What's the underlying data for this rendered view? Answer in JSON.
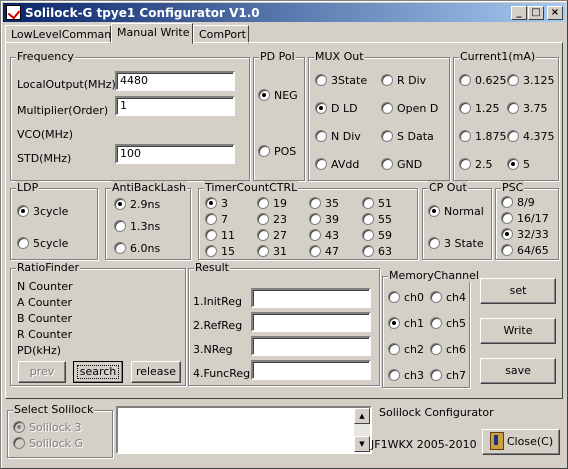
{
  "window": {
    "title": "Solilock-G tpye1 Configurator  V1.0"
  },
  "tabs": [
    {
      "label": "LowLevelCommand"
    },
    {
      "label": "Manual Write"
    },
    {
      "label": "ComPort"
    }
  ],
  "frequency": {
    "caption": "Frequency",
    "local_output_label": "LocalOutput(MHz)",
    "local_output_value": "4480",
    "multiplier_label": "Multiplier(Order)",
    "multiplier_value": "1",
    "vco_label": "VCO(MHz)",
    "std_label": "STD(MHz)",
    "std_value": "100"
  },
  "pd_pol": {
    "caption": "PD Pol",
    "options": [
      "NEG",
      "POS"
    ],
    "selected": "NEG"
  },
  "mux_out": {
    "caption": "MUX Out",
    "options": [
      "3State",
      "R Div",
      "D LD",
      "Open D",
      "N Div",
      "S Data",
      "AVdd",
      "GND"
    ],
    "selected": "D LD"
  },
  "current1": {
    "caption": "Current1(mA)",
    "options": [
      "0.625",
      "3.125",
      "1.25",
      "3.75",
      "1.875",
      "4.375",
      "2.5",
      "5"
    ],
    "selected": "5"
  },
  "ldp": {
    "caption": "LDP",
    "options": [
      "3cycle",
      "5cycle"
    ],
    "selected": "3cycle"
  },
  "antibacklash": {
    "caption": "AntiBackLash",
    "options": [
      "2.9ns",
      "1.3ns",
      "6.0ns"
    ],
    "selected": "2.9ns"
  },
  "timercount": {
    "caption": "TimerCountCTRL",
    "options": [
      "3",
      "19",
      "35",
      "51",
      "7",
      "23",
      "39",
      "55",
      "11",
      "27",
      "43",
      "59",
      "15",
      "31",
      "47",
      "63"
    ],
    "selected": "3"
  },
  "cp_out": {
    "caption": "CP Out",
    "options": [
      "Normal",
      "3 State"
    ],
    "selected": "Normal"
  },
  "psc": {
    "caption": "PSC",
    "options": [
      "8/9",
      "16/17",
      "32/33",
      "64/65"
    ],
    "selected": "32/33"
  },
  "ratiofinder": {
    "caption": "RatioFinder",
    "labels": [
      "N Counter",
      "A Counter",
      "B Counter",
      "R Counter",
      "PD(kHz)"
    ],
    "prev_label": "prev",
    "search_label": "search",
    "release_label": "release"
  },
  "result": {
    "caption": "Result",
    "labels": [
      "1.InitReg",
      "2.RefReg",
      "3.NReg",
      "4.FuncReg"
    ],
    "values": [
      "",
      "",
      "",
      ""
    ]
  },
  "memory_channel": {
    "caption": "MemoryChannel",
    "options": [
      "ch0",
      "ch4",
      "ch1",
      "ch5",
      "ch2",
      "ch6",
      "ch3",
      "ch7"
    ],
    "selected": "ch1"
  },
  "actions": {
    "set_label": "set",
    "write_label": "Write",
    "save_label": "save"
  },
  "select_solilock": {
    "caption": "Select Solilock",
    "options": [
      "Solilock 3",
      "Solilock G"
    ],
    "selected": "Solilock 3"
  },
  "footer": {
    "app_name": "Solilock Configurator",
    "copyright": "JF1WKX  2005-2010",
    "close_label": "Close(C)"
  },
  "icons": {
    "app": "app-icon",
    "close": "close-door-icon"
  }
}
